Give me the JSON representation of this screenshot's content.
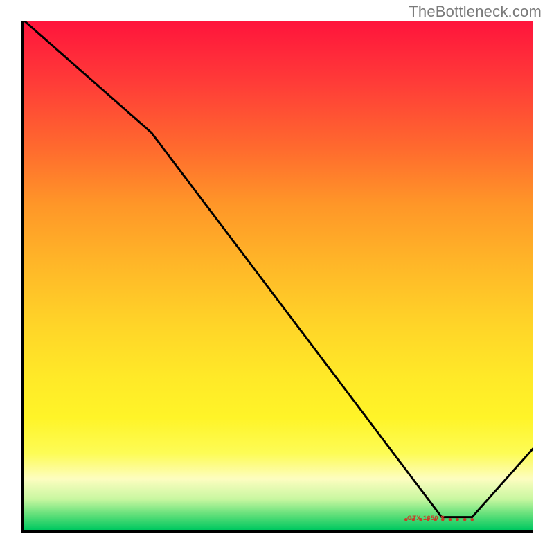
{
  "attribution": "TheBottleneck.com",
  "chart_data": {
    "type": "line",
    "title": "",
    "xlabel": "",
    "ylabel": "",
    "xlim": [
      0,
      100
    ],
    "ylim": [
      0,
      100
    ],
    "x": [
      0,
      25,
      82,
      88,
      100
    ],
    "values": [
      100,
      78,
      2.5,
      2.5,
      16
    ],
    "series_color": "#000000",
    "marker": {
      "x_start": 75,
      "x_end": 88,
      "y": 2,
      "label": "GTX 1650 S",
      "label_color": "#c83c28"
    },
    "background": "vertical-gradient red→yellow→green"
  }
}
